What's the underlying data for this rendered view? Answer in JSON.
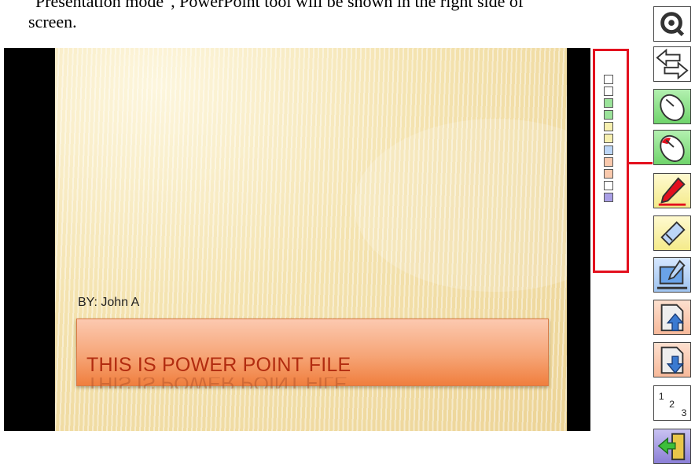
{
  "instructions": {
    "line1": "\"Presentation mode\", PowerPoint tool will be shown in the right side of",
    "line2": "screen."
  },
  "slide": {
    "subtitle": "BY: John A",
    "title": "THIS IS POWER POINT FILE"
  },
  "toolbar": {
    "items": [
      {
        "name": "zoom",
        "icon": "magnifier-icon",
        "color": "#ffffff"
      },
      {
        "name": "switch",
        "icon": "swap-arrows-icon",
        "color": "#ffffff"
      },
      {
        "name": "mouse",
        "icon": "mouse-icon",
        "color": "#9be39a"
      },
      {
        "name": "mouse-alt",
        "icon": "mouse-red-icon",
        "color": "#9be39a"
      },
      {
        "name": "pen",
        "icon": "pen-icon",
        "color": "#f7f0b0"
      },
      {
        "name": "eraser",
        "icon": "eraser-icon",
        "color": "#f7f0b0"
      },
      {
        "name": "erase-all",
        "icon": "monitor-pen-icon",
        "color": "#bcd6f7"
      },
      {
        "name": "previous",
        "icon": "page-up-icon",
        "color": "#f9c9ad"
      },
      {
        "name": "next",
        "icon": "page-down-icon",
        "color": "#f9c9ad"
      },
      {
        "name": "page-number",
        "icon": "numbers-icon",
        "color": "#ffffff"
      },
      {
        "name": "exit",
        "icon": "exit-door-icon",
        "color": "#a99fe6"
      }
    ],
    "page_number_digits": [
      "1",
      "2",
      "3"
    ]
  },
  "colors": {
    "highlight": "#e3101e",
    "title_text": "#b22c10"
  }
}
